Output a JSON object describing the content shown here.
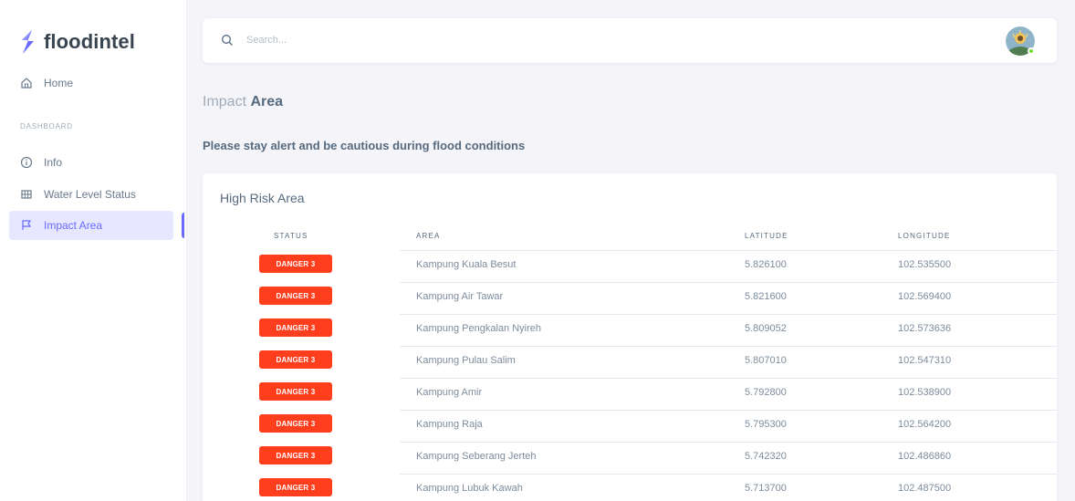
{
  "brand": {
    "name": "floodintel"
  },
  "sidebar": {
    "home_label": "Home",
    "section_header": "DASHBOARD",
    "items": [
      {
        "label": "Info",
        "icon": "info-circle-icon"
      },
      {
        "label": "Water Level Status",
        "icon": "grid-icon"
      },
      {
        "label": "Impact Area",
        "icon": "flag-icon"
      }
    ]
  },
  "navbar": {
    "search_placeholder": "Search..."
  },
  "page": {
    "title_prefix": "Impact",
    "title_strong": "Area",
    "alert": "Please stay alert and be cautious during flood conditions"
  },
  "card": {
    "title": "High Risk Area",
    "columns": [
      "STATUS",
      "AREA",
      "LATITUDE",
      "LONGITUDE"
    ],
    "rows": [
      {
        "status": "DANGER 3",
        "area": "Kampung Kuala Besut",
        "lat": "5.826100",
        "lon": "102.535500"
      },
      {
        "status": "DANGER 3",
        "area": "Kampung Air Tawar",
        "lat": "5.821600",
        "lon": "102.569400"
      },
      {
        "status": "DANGER 3",
        "area": "Kampung Pengkalan Nyireh",
        "lat": "5.809052",
        "lon": "102.573636"
      },
      {
        "status": "DANGER 3",
        "area": "Kampung Pulau Salim",
        "lat": "5.807010",
        "lon": "102.547310"
      },
      {
        "status": "DANGER 3",
        "area": "Kampung Amir",
        "lat": "5.792800",
        "lon": "102.538900"
      },
      {
        "status": "DANGER 3",
        "area": "Kampung Raja",
        "lat": "5.795300",
        "lon": "102.564200"
      },
      {
        "status": "DANGER 3",
        "area": "Kampung Seberang Jerteh",
        "lat": "5.742320",
        "lon": "102.486860"
      },
      {
        "status": "DANGER 3",
        "area": "Kampung Lubuk Kawah",
        "lat": "5.713700",
        "lon": "102.487500"
      }
    ]
  },
  "colors": {
    "accent": "#696cff",
    "danger": "#ff3e1d",
    "background": "#f5f5f9"
  }
}
